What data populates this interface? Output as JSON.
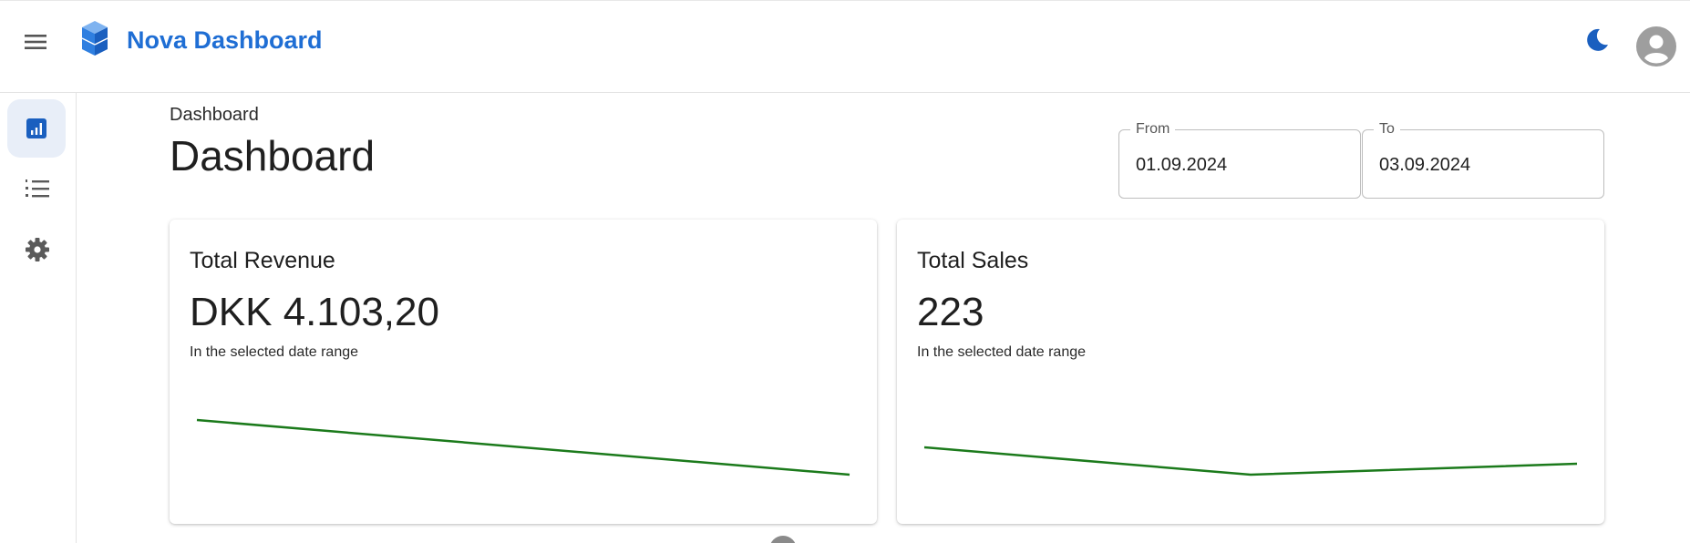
{
  "header": {
    "app_title": "Nova Dashboard",
    "menu_icon": "menu-icon",
    "logo_icon": "cube-stack-logo-icon",
    "theme_icon": "moon-icon",
    "avatar_icon": "account-circle-icon",
    "brand_color": "#1f6ed4"
  },
  "sidebar": {
    "items": [
      {
        "icon": "bar-chart-icon",
        "active": true
      },
      {
        "icon": "numbered-list-icon",
        "active": false
      },
      {
        "icon": "gear-icon",
        "active": false
      }
    ]
  },
  "main": {
    "breadcrumb": "Dashboard",
    "title": "Dashboard"
  },
  "filters": {
    "from": {
      "label": "From",
      "value": "01.09.2024"
    },
    "to": {
      "label": "To",
      "value": "03.09.2024"
    }
  },
  "cards": [
    {
      "title": "Total Revenue",
      "value": "DKK 4.103,20",
      "caption": "In the selected date range",
      "chart_data": {
        "type": "line",
        "values": [
          1.0,
          0.0
        ],
        "color": "#1b7a1b"
      }
    },
    {
      "title": "Total Sales",
      "value": "223",
      "caption": "In the selected date range",
      "chart_data": {
        "type": "line",
        "values": [
          0.5,
          0.0,
          0.2
        ],
        "color": "#1b7a1b"
      }
    }
  ]
}
